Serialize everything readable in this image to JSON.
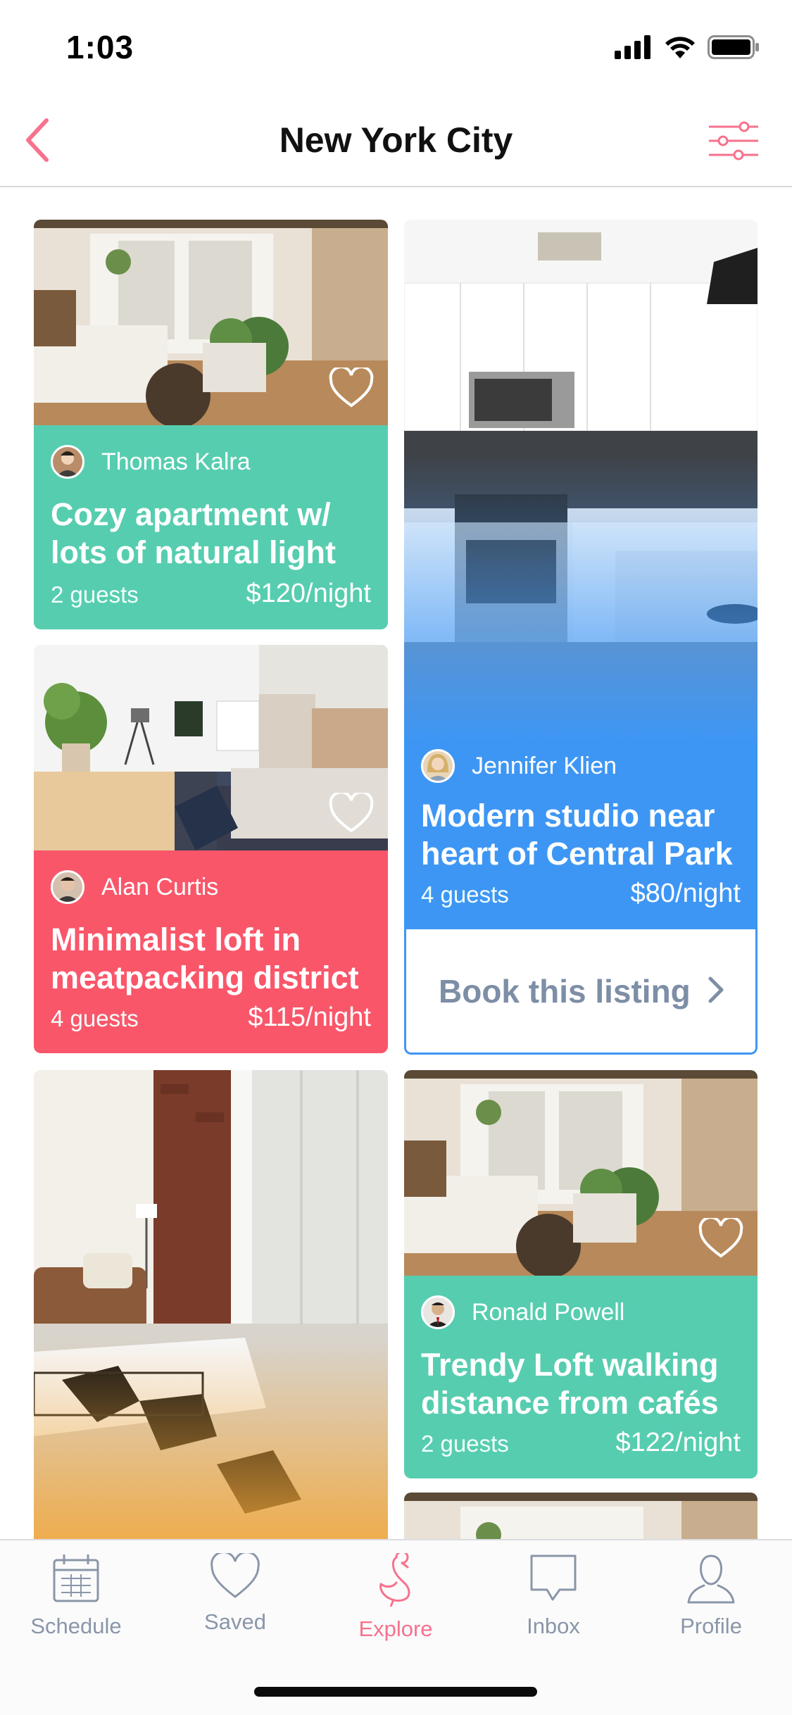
{
  "status": {
    "time": "1:03"
  },
  "nav": {
    "title": "New York City"
  },
  "listings": [
    {
      "host": "Thomas Kalra",
      "title": "Cozy apartment w/ lots of natural light",
      "guests": "2 guests",
      "price": "$120/night",
      "color": "#57cdb0"
    },
    {
      "host": "Jennifer Klien",
      "title": "Modern studio near heart of Central Park",
      "guests": "4 guests",
      "price": "$80/night",
      "color": "#3e96f4",
      "cta": "Book this listing"
    },
    {
      "host": "Alan Curtis",
      "title": "Minimalist loft in meatpacking district",
      "guests": "4 guests",
      "price": "$115/night",
      "color": "#fa566a"
    },
    {
      "host": "Ronald Powell",
      "title": "Trendy Loft walking distance from cafés",
      "guests": "2 guests",
      "price": "$122/night",
      "color": "#57cdb0"
    }
  ],
  "tabs": [
    {
      "label": "Schedule",
      "icon": "calendar-icon"
    },
    {
      "label": "Saved",
      "icon": "heart-icon"
    },
    {
      "label": "Explore",
      "icon": "flamingo-icon",
      "active": true
    },
    {
      "label": "Inbox",
      "icon": "chat-bubble-icon"
    },
    {
      "label": "Profile",
      "icon": "person-icon"
    }
  ],
  "colors": {
    "accent": "#f7728c",
    "green": "#57cdb0",
    "blue": "#3e96f4",
    "red": "#fa566a"
  }
}
